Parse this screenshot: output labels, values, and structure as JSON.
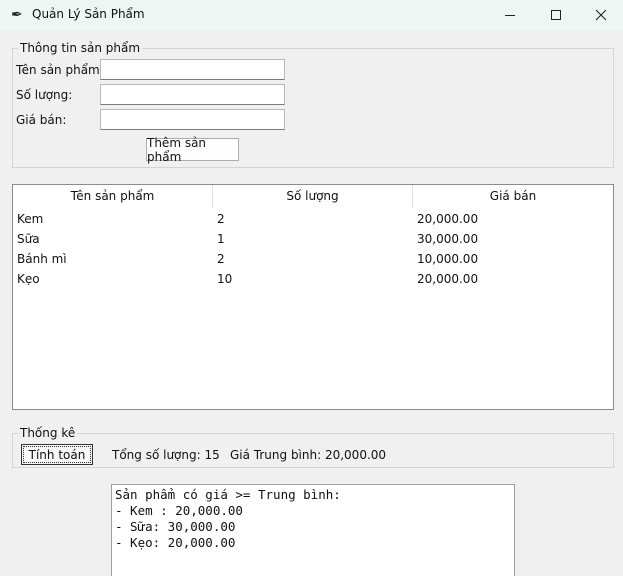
{
  "window": {
    "title": "Quản Lý Sản Phẩm",
    "icon": "feather-icon"
  },
  "form": {
    "legend": "Thông tin sản phẩm",
    "name_label": "Tên sản phẩm:",
    "name_value": "",
    "qty_label": "Số lượng:",
    "qty_value": "",
    "price_label": "Giá bán:",
    "price_value": "",
    "add_button": "Thêm sản phẩm"
  },
  "table": {
    "columns": [
      "Tên sản phẩm",
      "Số lượng",
      "Giá bán"
    ],
    "rows": [
      [
        "Kem",
        "2",
        "20,000.00"
      ],
      [
        "Sữa",
        "1",
        "30,000.00"
      ],
      [
        "Bánh mì",
        "2",
        "10,000.00"
      ],
      [
        "Kẹo",
        "10",
        "20,000.00"
      ]
    ]
  },
  "stats": {
    "legend": "Thống kê",
    "calc_button": "Tính toán",
    "total_qty": "Tổng số lượng: 15",
    "avg_price": "Giá Trung bình: 20,000.00"
  },
  "result": {
    "text": "Sản phẩm có giá >= Trung bình:\n- Kem : 20,000.00\n- Sữa: 30,000.00\n- Kẹo: 20,000.00"
  }
}
